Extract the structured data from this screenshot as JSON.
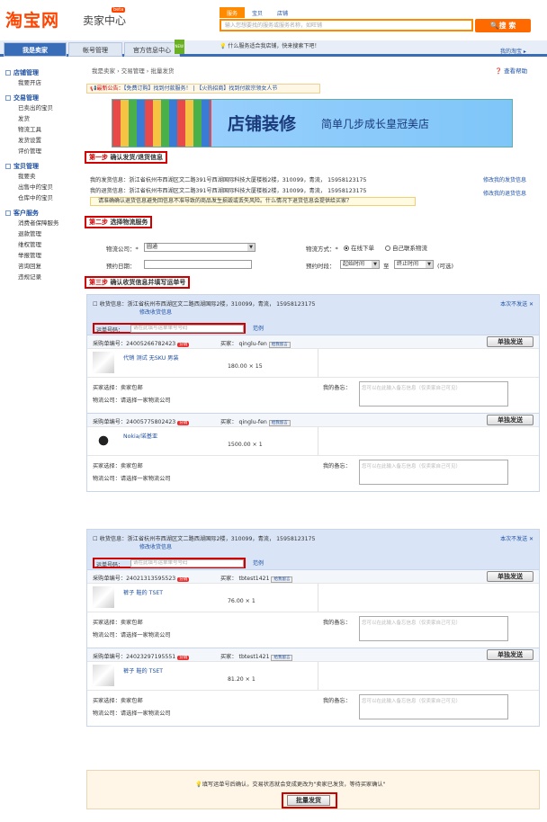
{
  "header": {
    "logo": "淘宝网",
    "title": "卖家中心",
    "beta": "beta",
    "search_tabs": [
      "服务",
      "宝贝",
      "店铺"
    ],
    "search_placeholder": "输入您想要找的服务或服务名称，如旺铺",
    "search_button": "搜 索"
  },
  "nav": {
    "tabs": [
      "我是卖家",
      "帐号管理",
      "官方信息中心"
    ],
    "new_badge": "NEW",
    "hint": "什么服务适合我店铺，快来搜索下吧！",
    "my_home": "我的淘宝 ▸"
  },
  "sidebar": [
    {
      "title": "店铺管理",
      "items": [
        "我要开店"
      ]
    },
    {
      "title": "交易管理",
      "items": [
        "已卖出的宝贝",
        "发货",
        "物流工具",
        "发货设置",
        "评价管理"
      ]
    },
    {
      "title": "宝贝管理",
      "items": [
        "我要卖",
        "出售中的宝贝",
        "仓库中的宝贝"
      ]
    },
    {
      "title": "客户服务",
      "items": [
        "消费者保障服务",
        "退款管理",
        "维权管理",
        "举报管理",
        "咨询回复",
        "违规记录"
      ]
    }
  ],
  "breadcrumb": "我是卖家 › 交易管理 › 批量发货",
  "help": "查看帮助",
  "notice": {
    "label": "最新公告：",
    "text": "【免费订购】找到付款服务！ | 【火热招商】找到付款宗领女人节"
  },
  "banner": {
    "title": "店铺装修",
    "subtitle": "简单几步成长皇冠美店"
  },
  "step1": {
    "num": "第一步",
    "title": "确认发货/退货信息",
    "ship_addr": "我的发货信息：浙江省杭州市西湖区文二路391号西湖国际科技大厦楼板2楼，310099，青流， 15958123175",
    "return_addr": "我的退货信息：浙江省杭州市西湖区文二路391号西湖国际科技大厦楼板2楼，310099，青流， 15958123175",
    "edit_ship": "修改我的发货信息",
    "edit_return": "修改我的退货信息",
    "warn": "请准确确认退货信息避免回信息不准导致的商品发生损毁或丢失风险。什么情况下退货信息会提供给买家？"
  },
  "step2": {
    "num": "第二步",
    "title": "选择物流服务",
    "company_label": "物流公司：*",
    "company_value": "圆通",
    "mode_label": "物流方式：*",
    "mode_online": "在线下单",
    "mode_self": "自己联系物流",
    "date_label": "预约日期：",
    "time_label": "预约时段：",
    "start": "起始时间",
    "to": "至",
    "end": "终止时间",
    "optional": "(可选)"
  },
  "step3": {
    "num": "第三步",
    "title": "确认收货信息并填写运单号"
  },
  "groups": [
    {
      "recv": "收货信息：浙江省杭州市西湖区文二路西湖国际2楼，310099，青流， 15958123175",
      "edit": "修改收货信息",
      "no_send": "本次不发送 ✕",
      "track_label": "运单号码：",
      "track_placeholder": "请在此填写运单单号号码",
      "range": "范例",
      "items": [
        {
          "pid": "采购单编号：24005266782423",
          "tag": "分销",
          "buyer": "买家： qinglu-fen",
          "wang": "给我留言",
          "send": "单独发送",
          "product": "代销 测试 无SKU 男装",
          "price": "180.00 × 15",
          "memo_placeholder": "您可以在此输入备忘信息（仅卖家自己可见）",
          "buyer_choice": "买家选择：卖家包邮",
          "logistics": "物流公司：请选择一家物流公司",
          "note_label": "我的备忘："
        },
        {
          "pid": "采购单编号：24005775802423",
          "tag": "分销",
          "buyer": "买家： qinglu-fen",
          "wang": "给我留言",
          "send": "单独发送",
          "product": "Nokia/诺基亚",
          "price": "1500.00 × 1",
          "memo_placeholder": "您可以在此输入备忘信息（仅卖家自己可见）",
          "buyer_choice": "买家选择：卖家包邮",
          "logistics": "物流公司：请选择一家物流公司",
          "note_label": "我的备忘："
        }
      ]
    },
    {
      "recv": "收货信息：浙江省杭州市西湖区文二路西湖国际2楼，310099，青流， 15958123175",
      "edit": "修改收货信息",
      "no_send": "本次不发送 ✕",
      "track_label": "运单号码：",
      "track_placeholder": "请在此填写运单单号号码",
      "range": "范例",
      "items": [
        {
          "pid": "采购单编号：24021313595523",
          "tag": "分销",
          "buyer": "买家： tbtest1421",
          "wang": "给我留言",
          "send": "单独发送",
          "product": "裤子 鞋的 TSET",
          "price": "76.00 × 1",
          "memo_placeholder": "您可以在此输入备忘信息（仅卖家自己可见）",
          "buyer_choice": "买家选择：卖家包邮",
          "logistics": "物流公司：请选择一家物流公司",
          "note_label": "我的备忘："
        },
        {
          "pid": "采购单编号：24023297195551",
          "tag": "分销",
          "buyer": "买家： tbtest1421",
          "wang": "给我留言",
          "send": "单独发送",
          "product": "裤子 鞋的 TSET",
          "price": "81.20 × 1",
          "memo_placeholder": "您可以在此输入备忘信息（仅卖家自己可见）",
          "buyer_choice": "买家选择：卖家包邮",
          "logistics": "物流公司：请选择一家物流公司",
          "note_label": "我的备忘："
        }
      ]
    }
  ],
  "bottom": {
    "msg": "填写运单号后确认，交易状态就会变成更改为\"卖家已发货，等待买家确认\"",
    "batch": "批量发货"
  }
}
